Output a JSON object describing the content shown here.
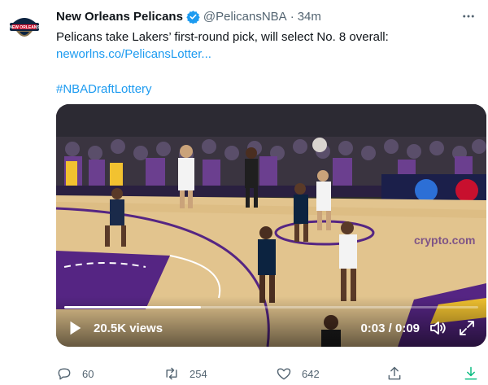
{
  "tweet": {
    "author_name": "New Orleans Pelicans",
    "handle": "@PelicansNBA",
    "separator": "·",
    "time": "34m",
    "text_line": "Pelicans take Lakers’ first-round pick, will select No. 8 overall:",
    "link": "neworlns.co/PelicansLotter...",
    "hashtag": "#NBADraftLottery"
  },
  "video": {
    "views": "20.5K views",
    "timecode": "0:03 / 0:09",
    "progress": 0.33
  },
  "actions": {
    "reply_count": "60",
    "retweet_count": "254",
    "like_count": "642"
  },
  "icons": {
    "avatar": "pelicans-logo",
    "verified": "verified-badge-icon",
    "more": "more-horizontal-icon",
    "play": "play-icon",
    "volume": "volume-icon",
    "fullscreen": "fullscreen-icon",
    "reply": "reply-icon",
    "retweet": "retweet-icon",
    "like": "heart-icon",
    "share": "share-icon",
    "download": "download-icon"
  },
  "colors": {
    "accent": "#1d9bf0",
    "muted": "#536471",
    "download": "#00ba7c",
    "court": "#e2c48e",
    "paint": "#552583"
  }
}
